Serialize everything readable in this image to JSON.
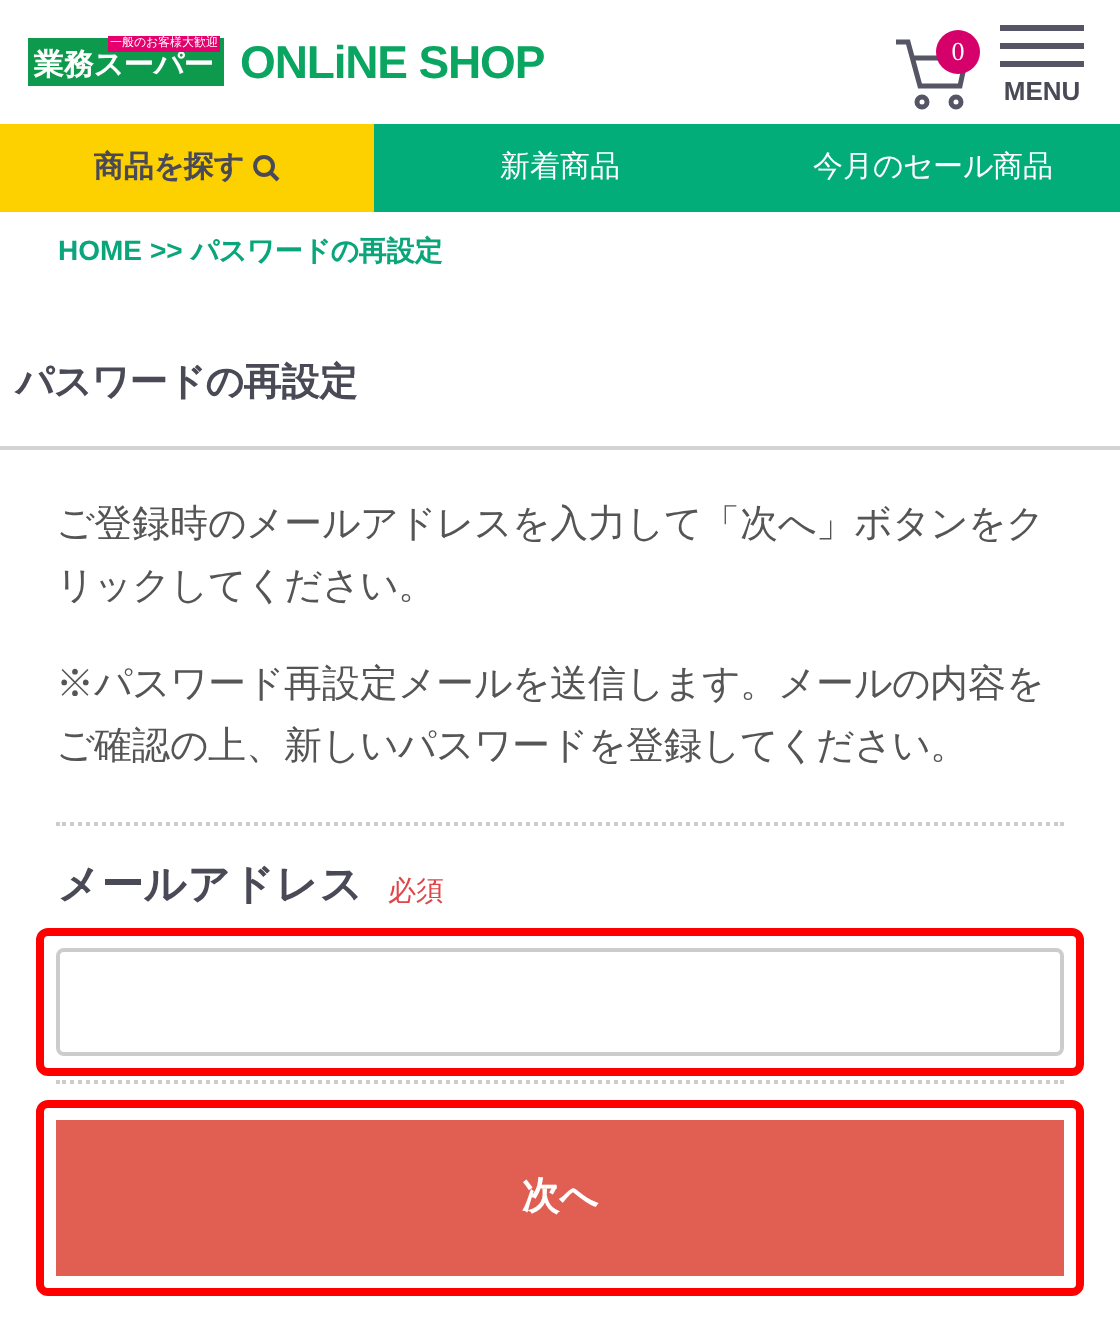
{
  "header": {
    "logo": {
      "main": "業務スーパー",
      "banner": "一般のお客様大歓迎",
      "shop": "ONLiNE SHOP"
    },
    "cart_count": "0",
    "menu_label": "MENU"
  },
  "nav_tabs": [
    {
      "label": "商品を探す",
      "selected": true,
      "search_icon": true
    },
    {
      "label": "新着商品",
      "selected": false,
      "search_icon": false
    },
    {
      "label": "今月のセール商品",
      "selected": false,
      "search_icon": false
    }
  ],
  "breadcrumb": [
    "HOME",
    ">>",
    "パスワードの再設定"
  ],
  "page_title": "パスワードの再設定",
  "paragraphs": [
    "ご登録時のメールアドレスを入力して「次へ」ボタンをクリックしてください。",
    "※パスワード再設定メールを送信します。メールの内容をご確認の上、新しいパスワードを登録してください。"
  ],
  "email_field": {
    "label": "メールアドレス",
    "required": "必須",
    "highlighted": true
  },
  "submit_button": {
    "label": "次へ",
    "highlighted": true
  }
}
